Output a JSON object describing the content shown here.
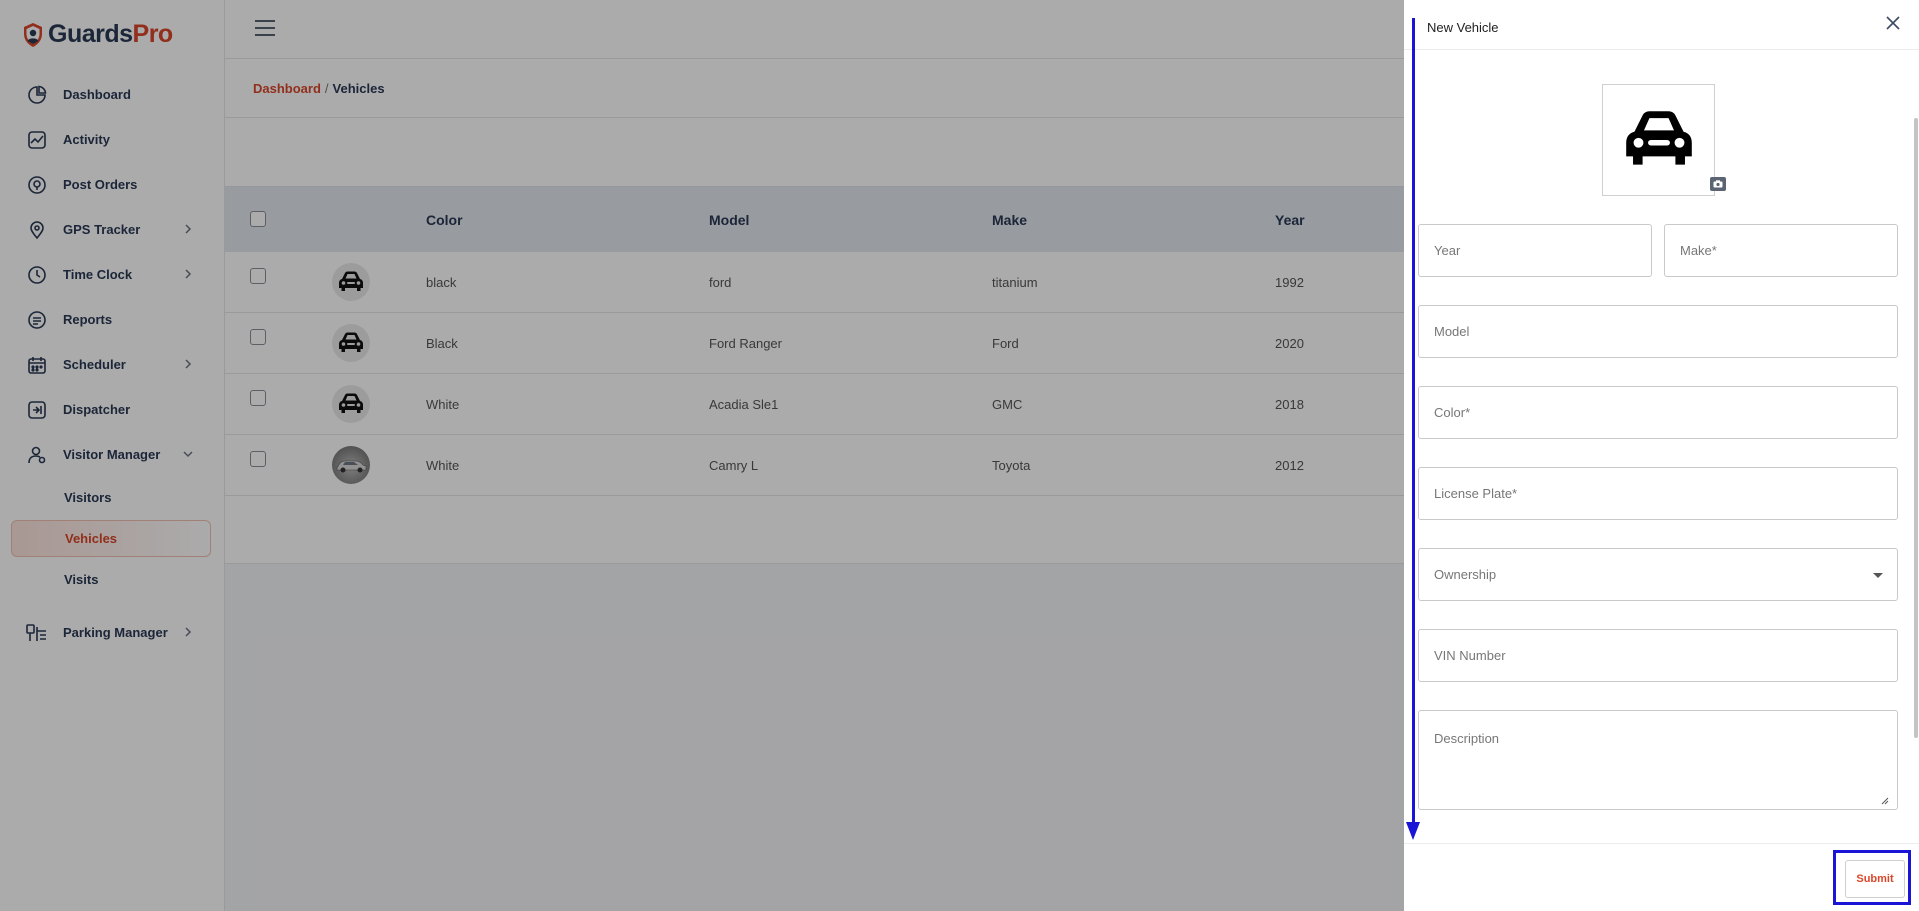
{
  "app": {
    "logo_part1": "Guards",
    "logo_part2": "Pro",
    "brand_color": "#d9472b",
    "navy_color": "#2b3a55"
  },
  "sidebar": {
    "items": [
      {
        "label": "Dashboard",
        "icon": "dashboard-icon"
      },
      {
        "label": "Activity",
        "icon": "activity-icon"
      },
      {
        "label": "Post Orders",
        "icon": "post-orders-icon"
      },
      {
        "label": "GPS Tracker",
        "icon": "gps-tracker-icon",
        "expandable": true
      },
      {
        "label": "Time Clock",
        "icon": "clock-icon",
        "expandable": true
      },
      {
        "label": "Reports",
        "icon": "reports-icon"
      },
      {
        "label": "Scheduler",
        "icon": "calendar-icon",
        "expandable": true
      },
      {
        "label": "Dispatcher",
        "icon": "dispatcher-icon"
      },
      {
        "label": "Visitor Manager",
        "icon": "visitor-icon",
        "expanded": true
      },
      {
        "label": "Parking Manager",
        "icon": "parking-icon",
        "expandable": true
      }
    ],
    "visitor_sub": [
      {
        "label": "Visitors"
      },
      {
        "label": "Vehicles",
        "active": true
      },
      {
        "label": "Visits"
      }
    ]
  },
  "breadcrumb": {
    "root": "Dashboard",
    "separator": "/",
    "current": "Vehicles"
  },
  "table": {
    "columns": [
      "Color",
      "Model",
      "Make",
      "Year"
    ],
    "rows": [
      {
        "color": "black",
        "model": "ford",
        "make": "titanium",
        "year": "1992",
        "avatar": "car-icon"
      },
      {
        "color": "Black",
        "model": "Ford Ranger",
        "make": "Ford",
        "year": "2020",
        "avatar": "car-icon"
      },
      {
        "color": "White",
        "model": "Acadia Sle1",
        "make": "GMC",
        "year": "2018",
        "avatar": "car-icon"
      },
      {
        "color": "White",
        "model": "Camry L",
        "make": "Toyota",
        "year": "2012",
        "avatar": "car-photo"
      }
    ]
  },
  "drawer": {
    "title": "New Vehicle",
    "fields": {
      "year": {
        "placeholder": "Year",
        "value": ""
      },
      "make": {
        "placeholder": "Make*",
        "value": ""
      },
      "model": {
        "placeholder": "Model",
        "value": ""
      },
      "color": {
        "placeholder": "Color*",
        "value": ""
      },
      "license_plate": {
        "placeholder": "License Plate*",
        "value": ""
      },
      "ownership": {
        "placeholder": "Ownership",
        "value": ""
      },
      "vin": {
        "placeholder": "VIN Number",
        "value": ""
      },
      "description": {
        "placeholder": "Description",
        "value": ""
      }
    },
    "submit_label": "Submit"
  },
  "annotation_color": "#1a14d6"
}
